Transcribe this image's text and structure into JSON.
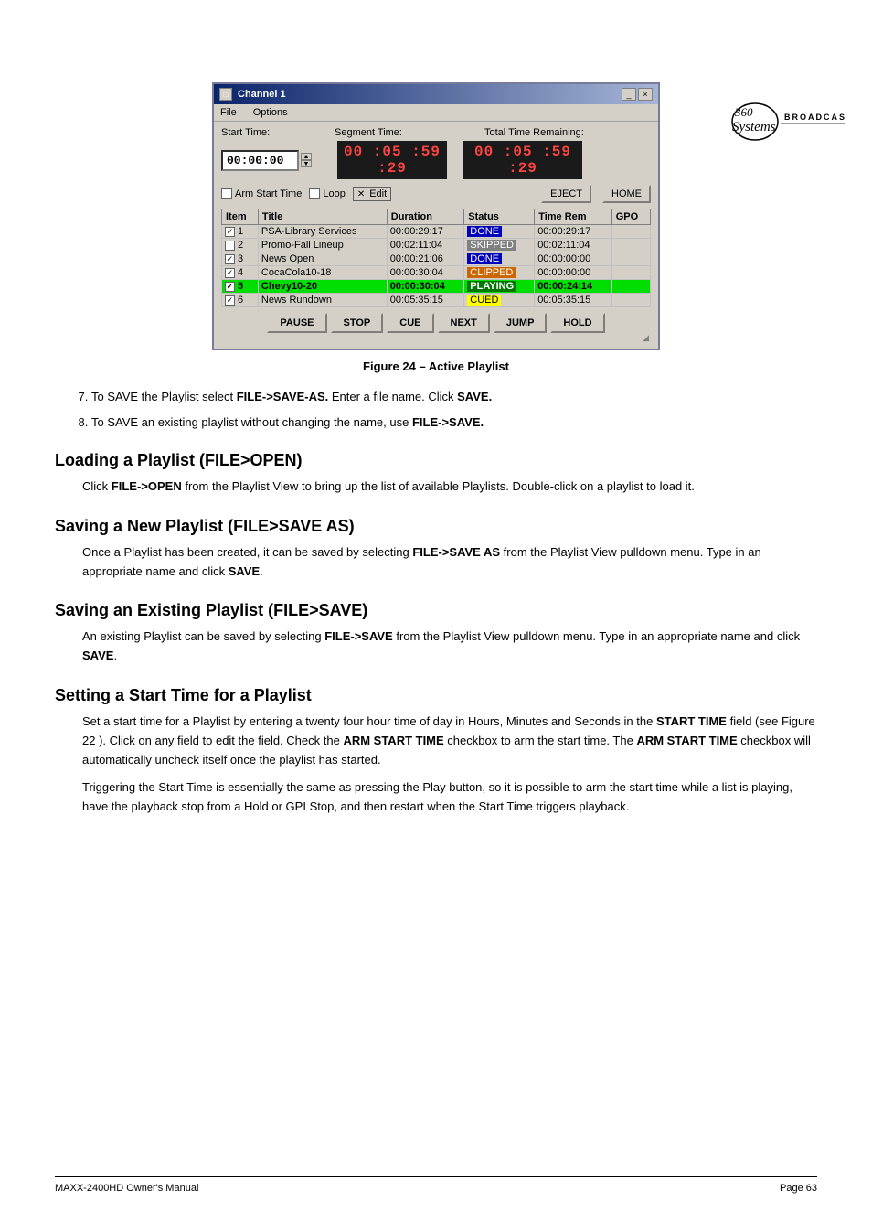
{
  "logo": {
    "text": "360 Systems",
    "sub": "BROADCAST"
  },
  "window": {
    "title": "Channel  1",
    "menu": [
      "File",
      "Options"
    ],
    "labels": {
      "start_time": "Start Time:",
      "segment_time": "Segment Time:",
      "total_time": "Total Time Remaining:"
    },
    "values": {
      "start_time": "00:00:00",
      "segment_time": "00 :05 :59 :29",
      "total_time": "00 :05 :59 :29"
    },
    "checkboxes": {
      "arm_start": "Arm Start Time",
      "loop": "Loop",
      "edit": "Edit"
    },
    "buttons": {
      "eject": "EJECT",
      "home": "HOME"
    },
    "table": {
      "headers": [
        "Item",
        "Title",
        "Duration",
        "Status",
        "Time Rem",
        "GPO"
      ],
      "rows": [
        {
          "check": true,
          "num": "1",
          "title": "PSA-Library Services",
          "duration": "00:00:29:17",
          "status": "DONE",
          "status_type": "done",
          "time_rem": "00:00:29:17",
          "gpo": ""
        },
        {
          "check": false,
          "num": "2",
          "title": "Promo-Fall Lineup",
          "duration": "00:02:11:04",
          "status": "SKIPPED",
          "status_type": "skipped",
          "time_rem": "00:02:11:04",
          "gpo": ""
        },
        {
          "check": true,
          "num": "3",
          "title": "News Open",
          "duration": "00:00:21:06",
          "status": "DONE",
          "status_type": "done",
          "time_rem": "00:00:00:00",
          "gpo": ""
        },
        {
          "check": true,
          "num": "4",
          "title": "CocaCola10-18",
          "duration": "00:00:30:04",
          "status": "CLIPPED",
          "status_type": "clipped",
          "time_rem": "00:00:00:00",
          "gpo": ""
        },
        {
          "check": true,
          "num": "5",
          "title": "Chevy10-20",
          "duration": "00:00:30:04",
          "status": "PLAYING",
          "status_type": "playing",
          "time_rem": "00:00:24:14",
          "gpo": "",
          "row_class": "row-playing"
        },
        {
          "check": true,
          "num": "6",
          "title": "News Rundown",
          "duration": "00:05:35:15",
          "status": "CUED",
          "status_type": "cued",
          "time_rem": "00:05:35:15",
          "gpo": ""
        }
      ]
    },
    "action_buttons": [
      "PAUSE",
      "STOP",
      "CUE",
      "NEXT",
      "JUMP",
      "HOLD"
    ]
  },
  "figure_caption": "Figure 24 – Active Playlist",
  "numbered_items": [
    {
      "num": "7.",
      "text": "To SAVE the Playlist select ",
      "bold1": "FILE->SAVE-AS.",
      "text2": " Enter a file name. Click ",
      "bold2": "SAVE."
    },
    {
      "num": "8.",
      "text": "To SAVE an existing playlist without changing the name, use ",
      "bold1": "FILE->SAVE."
    }
  ],
  "sections": [
    {
      "heading": "Loading a Playlist (FILE>OPEN)",
      "paragraphs": [
        "Click FILE->OPEN from the Playlist View to bring up the list of available Playlists. Double-click on a playlist to load it."
      ]
    },
    {
      "heading": "Saving a New Playlist (FILE>SAVE AS)",
      "paragraphs": [
        "Once a Playlist has been created, it can be saved by selecting FILE->SAVE AS from the Playlist View pulldown menu. Type in an appropriate name and click SAVE."
      ]
    },
    {
      "heading": "Saving an Existing Playlist (FILE>SAVE)",
      "paragraphs": [
        "An existing Playlist can be saved by selecting FILE->SAVE from the Playlist View pulldown menu. Type in an appropriate name and click SAVE."
      ]
    },
    {
      "heading": "Setting a Start Time for a Playlist",
      "paragraphs": [
        "Set a start time for a Playlist by entering a twenty four hour time of day in Hours, Minutes and Seconds in the START TIME field (see Figure 22 ). Click on any field to edit the field. Check the ARM START TIME checkbox to arm the start time. The ARM START TIME checkbox will automatically uncheck itself once the playlist has started.",
        "Triggering the Start Time is essentially the same as pressing the Play button, so it is possible to arm the start time while a list is playing, have the playback stop from a Hold or GPI Stop, and then restart when the Start Time triggers playback."
      ]
    }
  ],
  "footer": {
    "left": "MAXX-2400HD Owner's Manual",
    "right": "Page 63"
  }
}
